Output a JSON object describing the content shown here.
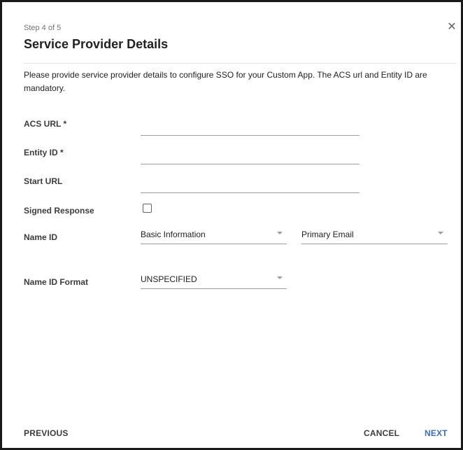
{
  "dialog": {
    "step": "Step 4 of 5",
    "title": "Service Provider Details",
    "description": "Please provide service provider details to configure SSO for your Custom App. The ACS url and Entity ID are mandatory."
  },
  "fields": {
    "acs_url_label": "ACS URL *",
    "acs_url_value": "",
    "entity_id_label": "Entity ID *",
    "entity_id_value": "",
    "start_url_label": "Start URL",
    "start_url_value": "",
    "signed_response_label": "Signed Response",
    "signed_response_checked": false,
    "name_id_label": "Name ID",
    "name_id_category": "Basic Information",
    "name_id_attribute": "Primary Email",
    "name_id_format_label": "Name ID Format",
    "name_id_format_value": "UNSPECIFIED"
  },
  "footer": {
    "previous": "PREVIOUS",
    "cancel": "CANCEL",
    "next": "NEXT"
  },
  "colors": {
    "accent": "#3b6fb6",
    "text": "#212121",
    "muted": "#757575"
  },
  "icons": {
    "close": "close-icon",
    "dropdown": "chevron-down-icon"
  }
}
